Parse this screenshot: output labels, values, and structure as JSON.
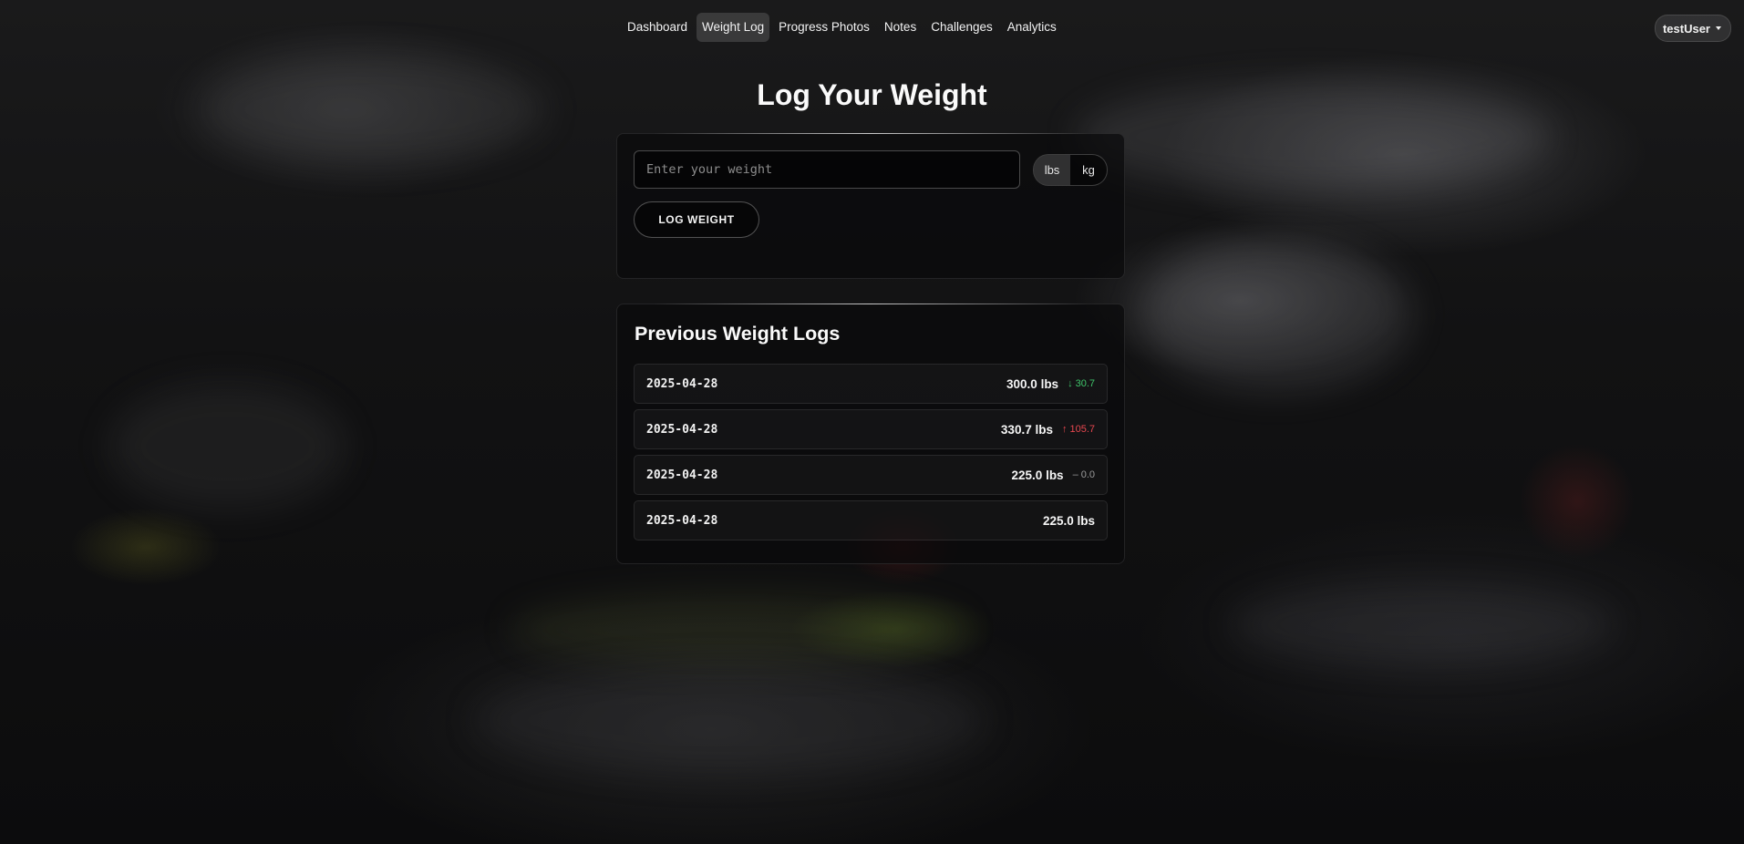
{
  "nav": {
    "links": [
      {
        "label": "Dashboard",
        "active": false
      },
      {
        "label": "Weight Log",
        "active": true
      },
      {
        "label": "Progress Photos",
        "active": false
      },
      {
        "label": "Notes",
        "active": false
      },
      {
        "label": "Challenges",
        "active": false
      },
      {
        "label": "Analytics",
        "active": false
      }
    ],
    "user": "testUser"
  },
  "page": {
    "title": "Log Your Weight"
  },
  "log_form": {
    "input_value": "",
    "input_placeholder": "Enter your weight",
    "units": [
      {
        "label": "lbs",
        "selected": true
      },
      {
        "label": "kg",
        "selected": false
      }
    ],
    "submit_label": "LOG WEIGHT"
  },
  "previous": {
    "title": "Previous Weight Logs",
    "entries": [
      {
        "date": "2025-04-28",
        "weight": "300.0 lbs",
        "change_icon": "↓",
        "change": "30.7",
        "trend": "down"
      },
      {
        "date": "2025-04-28",
        "weight": "330.7 lbs",
        "change_icon": "↑",
        "change": "105.7",
        "trend": "up"
      },
      {
        "date": "2025-04-28",
        "weight": "225.0 lbs",
        "change_icon": "–",
        "change": "0.0",
        "trend": "same"
      },
      {
        "date": "2025-04-28",
        "weight": "225.0 lbs",
        "change_icon": "",
        "change": "",
        "trend": "none"
      }
    ]
  },
  "colors": {
    "decrease": "#3fc56a",
    "increase": "#e8474f",
    "neutral": "#9a9a9a"
  }
}
